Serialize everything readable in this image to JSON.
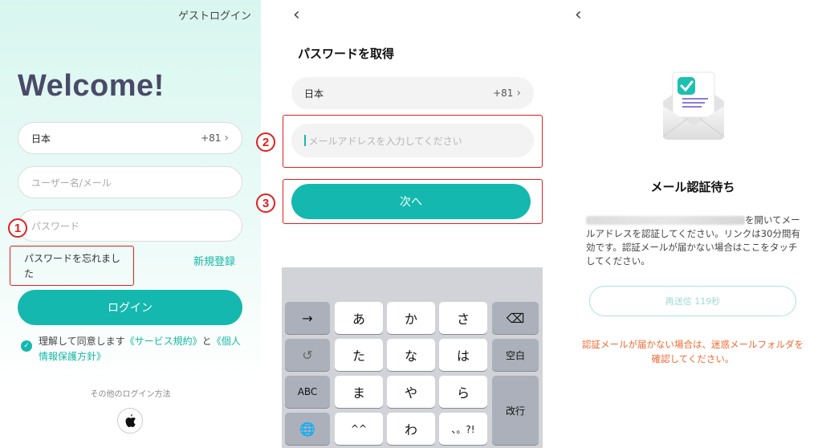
{
  "login": {
    "guest_login": "ゲストログイン",
    "welcome": "Welcome!",
    "country": "日本",
    "country_code": "+81",
    "username_placeholder": "ユーザー名/メール",
    "password_placeholder": "パスワード",
    "forgot_password": "パスワードを忘れました",
    "register": "新規登録",
    "login_button": "ログイン",
    "agree_prefix": "理解して同意します",
    "terms_link": "《サービス規約》",
    "agree_and": "と",
    "privacy_link": "《個人情報保護方針》",
    "other_login": "その他のログイン方法",
    "marker": "1"
  },
  "reset": {
    "title": "パスワードを取得",
    "country": "日本",
    "country_code": "+81",
    "email_placeholder": "メールアドレスを入力してください",
    "next_button": "次へ",
    "marker_email": "2",
    "marker_next": "3",
    "keyboard": {
      "arrow": "→",
      "row1": [
        "あ",
        "か",
        "さ"
      ],
      "delete": "⌫",
      "undo": "↺",
      "row2": [
        "た",
        "な",
        "は"
      ],
      "space": "空白",
      "abc": "ABC",
      "row3": [
        "ま",
        "や",
        "ら"
      ],
      "enter": "改行",
      "globe": "🌐",
      "row4": [
        "^^",
        "わ",
        "、。?!"
      ]
    }
  },
  "verify": {
    "title": "メール認証待ち",
    "desc_after_email": "を開いてメールアドレスを認証してください。リンクは30分間有効です。認証メールが届かない場合はここをタッチしてください。",
    "resend_button": "再送信 119秒",
    "warning": "認証メールが届かない場合は、迷惑メールフォルダを確認してください。"
  },
  "colors": {
    "accent": "#14b8ae",
    "marker": "#e02020",
    "warning": "#f06a32"
  }
}
